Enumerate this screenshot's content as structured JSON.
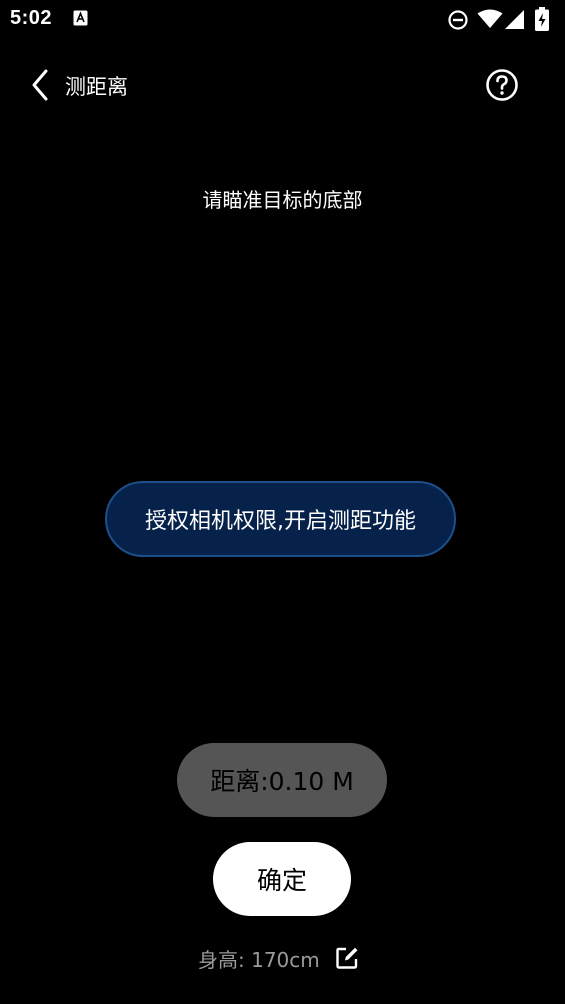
{
  "status_bar": {
    "time": "5:02",
    "app_icon": "a-letter-icon",
    "icons": [
      "do-not-disturb-icon",
      "wifi-icon",
      "signal-icon",
      "battery-charging-icon"
    ]
  },
  "toolbar": {
    "title": "测距离",
    "back_icon": "chevron-left-icon",
    "help_icon": "help-circle-icon"
  },
  "instruction": "请瞄准目标的底部",
  "auth_button_label": "授权相机权限,开启测距功能",
  "distance": {
    "label": "距离:0.10 M"
  },
  "confirm_label": "确定",
  "height": {
    "label": "身高: 170cm",
    "edit_icon": "edit-icon"
  },
  "colors": {
    "background": "#000000",
    "auth_button_bg": "#06224a",
    "auth_button_border": "#1d4f8a",
    "distance_pill_bg": "#555555",
    "confirm_bg": "#ffffff",
    "height_text": "#9a9a9a"
  }
}
